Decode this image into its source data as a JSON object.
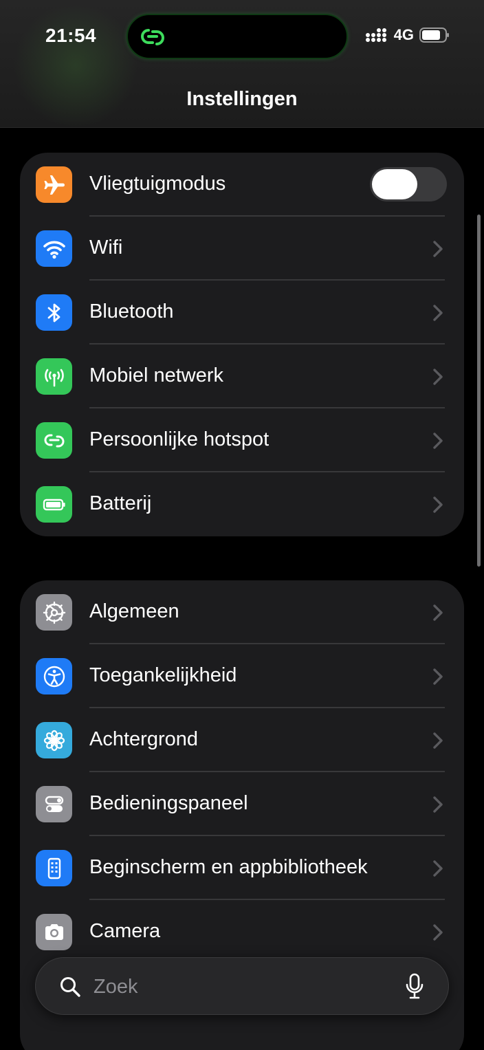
{
  "status": {
    "time": "21:54",
    "network": "4G"
  },
  "header": {
    "title": "Instellingen"
  },
  "group1": [
    {
      "label": "Vliegtuigmodus",
      "icon": "airplane-icon",
      "color": "#F7892B"
    },
    {
      "label": "Wifi",
      "icon": "wifi-icon",
      "color": "#1F7BF6"
    },
    {
      "label": "Bluetooth",
      "icon": "bluetooth-icon",
      "color": "#1F7BF6"
    },
    {
      "label": "Mobiel netwerk",
      "icon": "antenna-icon",
      "color": "#34C759"
    },
    {
      "label": "Persoonlijke hotspot",
      "icon": "chain-link-icon",
      "color": "#34C759"
    },
    {
      "label": "Batterij",
      "icon": "battery-icon",
      "color": "#34C759"
    }
  ],
  "group2": [
    {
      "label": "Algemeen",
      "icon": "gear-icon",
      "color": "#8E8E93"
    },
    {
      "label": "Toegankelijkheid",
      "icon": "accessibility-icon",
      "color": "#1F7BF6"
    },
    {
      "label": "Achtergrond",
      "icon": "flower-icon",
      "color": "#35AADC"
    },
    {
      "label": "Bedieningspaneel",
      "icon": "toggles-icon",
      "color": "#8E8E93"
    },
    {
      "label": "Beginscherm en appbibliotheek",
      "icon": "phone-grid-icon",
      "color": "#1F7BF6"
    },
    {
      "label": "Camera",
      "icon": "camera-icon",
      "color": "#8E8E93"
    }
  ],
  "toggle": {
    "airplane_mode_on": false
  },
  "search": {
    "placeholder": "Zoek"
  }
}
